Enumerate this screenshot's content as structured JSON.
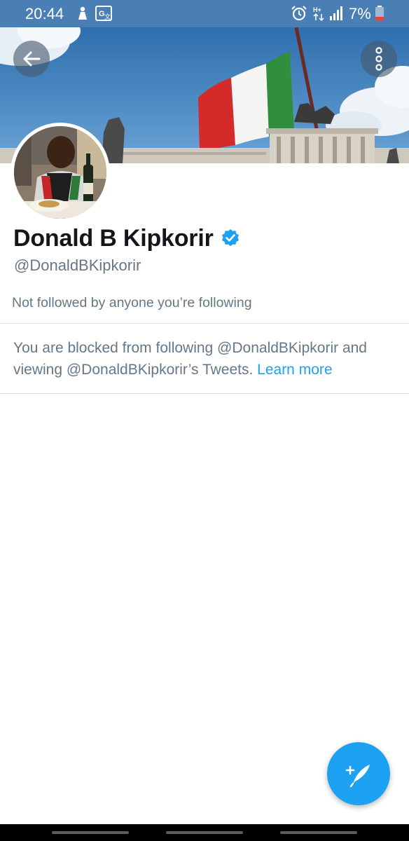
{
  "status_bar": {
    "time": "20:44",
    "battery_percent": "7%",
    "icons": [
      "notification-icon",
      "translate-icon",
      "alarm-icon",
      "network-hplus-icon",
      "signal-icon",
      "battery-low-icon"
    ]
  },
  "header": {
    "back_icon": "arrow-left-icon",
    "more_icon": "more-vertical-icon"
  },
  "profile": {
    "display_name": "Donald B Kipkorir",
    "verified": true,
    "handle": "@DonaldBKipkorir",
    "followers_you_know": "Not followed by anyone you’re following"
  },
  "blocked_notice": {
    "text": "You are blocked from following @DonaldBKipkorir and viewing @DonaldBKipkorir’s Tweets.",
    "link_label": "Learn more"
  },
  "fab": {
    "icon": "compose-tweet-icon"
  },
  "colors": {
    "accent": "#1da1f2",
    "text_primary": "#14171a",
    "text_secondary": "#657786",
    "status_bar": "#4a7fb5"
  }
}
